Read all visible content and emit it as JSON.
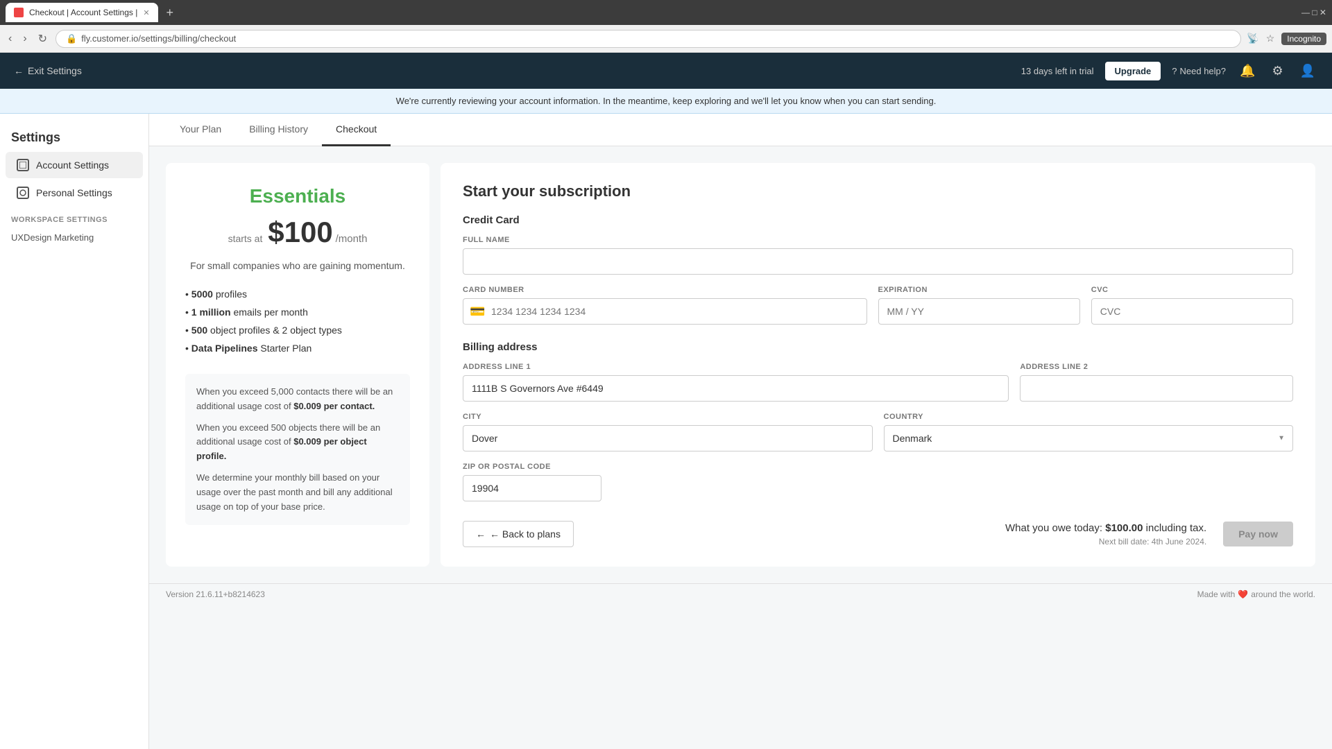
{
  "browser": {
    "tab_label": "Checkout | Account Settings |",
    "url": "fly.customer.io/settings/billing/checkout",
    "incognito_label": "Incognito",
    "new_tab_label": "+"
  },
  "topbar": {
    "exit_label": "Exit Settings",
    "trial_text": "13 days left in trial",
    "upgrade_label": "Upgrade",
    "need_help_label": "Need help?"
  },
  "info_banner": {
    "text": "We're currently reviewing your account information. In the meantime, keep exploring and we'll let you know when you can start sending."
  },
  "sidebar": {
    "title": "Settings",
    "account_settings_label": "Account Settings",
    "personal_settings_label": "Personal Settings",
    "workspace_section": "WORKSPACE SETTINGS",
    "workspace_name": "UXDesign Marketing"
  },
  "tabs": [
    {
      "label": "Your Plan",
      "active": false
    },
    {
      "label": "Billing History",
      "active": false
    },
    {
      "label": "Checkout",
      "active": true
    }
  ],
  "plan": {
    "name": "Essentials",
    "starts_at": "starts at",
    "price": "$100",
    "per_month": "/month",
    "description": "For small companies who are gaining momentum.",
    "features": [
      {
        "bold": "5000",
        "text": " profiles"
      },
      {
        "bold": "1 million",
        "text": " emails per month"
      },
      {
        "bold": "500",
        "text": " object profiles & 2 object types"
      },
      {
        "bold": "Data Pipelines",
        "text": " Starter Plan"
      }
    ],
    "usage_notes": [
      "When you exceed 5,000 contacts there will be an additional usage cost of $0.009 per contact.",
      "When you exceed 500 objects there will be an additional usage cost of $0.009 per object profile.",
      "We determine your monthly bill based on your usage over the past month and bill any additional usage on top of your base price."
    ]
  },
  "subscription": {
    "title": "Start your subscription",
    "credit_card_label": "Credit Card",
    "full_name_label": "FULL NAME",
    "full_name_placeholder": "",
    "card_number_label": "CARD NUMBER",
    "card_number_placeholder": "1234 1234 1234 1234",
    "expiration_label": "EXPIRATION",
    "expiration_placeholder": "MM / YY",
    "cvc_label": "CVC",
    "cvc_placeholder": "CVC",
    "billing_address_label": "Billing address",
    "address_line1_label": "ADDRESS LINE 1",
    "address_line1_value": "1111B S Governors Ave #6449",
    "address_line2_label": "ADDRESS LINE 2",
    "address_line2_value": "",
    "city_label": "CITY",
    "city_value": "Dover",
    "country_label": "COUNTRY",
    "country_value": "Denmark",
    "zip_label": "ZIP OR POSTAL CODE",
    "zip_value": "19904",
    "back_label": "← Back to plans",
    "owe_text": "What you owe today:",
    "owe_amount": "$100.00",
    "owe_suffix": "including tax.",
    "next_bill": "Next bill date: 4th June 2024.",
    "pay_label": "Pay now"
  },
  "footer": {
    "version": "Version 21.6.11+b8214623",
    "made_with": "Made with",
    "around": "around the world."
  }
}
